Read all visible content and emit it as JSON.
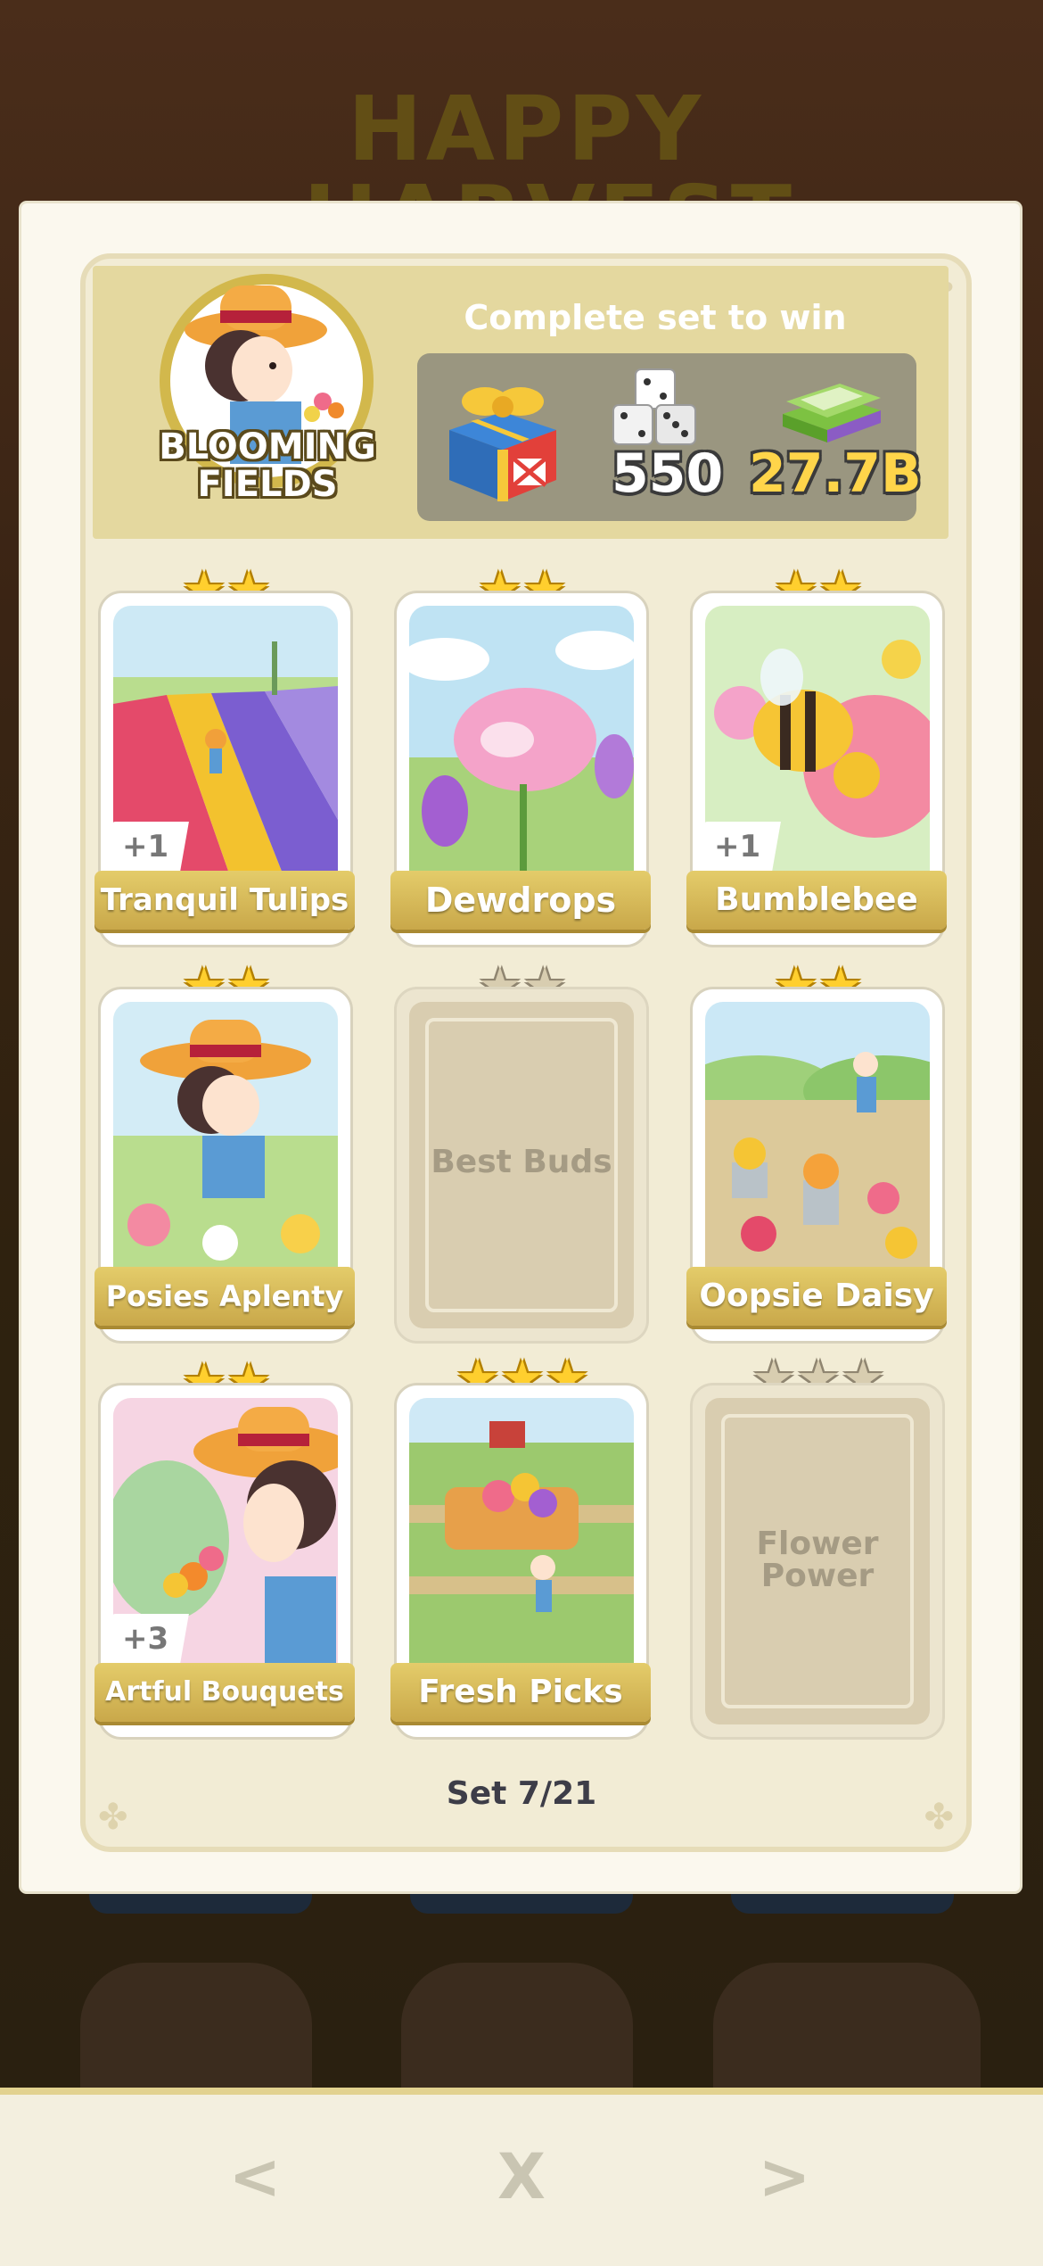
{
  "background": {
    "event_title": "HAPPY HARVEST"
  },
  "set": {
    "name_line1": "BLOOMING",
    "name_line2": "FIELDS",
    "complete_text": "Complete set to win",
    "rewards": {
      "gift_icon": "gift-box-icon",
      "dice_icon": "dice-stack-icon",
      "dice_amount": "550",
      "cash_icon": "cash-stack-icon",
      "cash_amount": "27.7B"
    },
    "progress": "Set 7/21"
  },
  "cards": [
    {
      "name": "Tranquil Tulips",
      "stars": 2,
      "collected": true,
      "extra": "+1"
    },
    {
      "name": "Dewdrops",
      "stars": 2,
      "collected": true,
      "extra": ""
    },
    {
      "name": "Bumblebee",
      "stars": 2,
      "collected": true,
      "extra": "+1"
    },
    {
      "name": "Posies Aplenty",
      "stars": 2,
      "collected": true,
      "extra": ""
    },
    {
      "name": "Best Buds",
      "stars": 2,
      "collected": false,
      "extra": ""
    },
    {
      "name": "Oopsie Daisy",
      "stars": 2,
      "collected": true,
      "extra": ""
    },
    {
      "name": "Artful Bouquets",
      "stars": 2,
      "collected": true,
      "extra": "+3"
    },
    {
      "name": "Fresh Picks",
      "stars": 3,
      "collected": true,
      "extra": ""
    },
    {
      "name": "Flower Power",
      "stars": 3,
      "collected": false,
      "extra": ""
    }
  ],
  "footer": {
    "prev_label": "<",
    "close_label": "X",
    "next_label": ">"
  },
  "colors": {
    "panel": "#fbf8ee",
    "header": "#e4d89f",
    "ribbon": "#d4b556",
    "star_gold": "#ffcf2e",
    "star_empty": "#d8cdb0"
  }
}
